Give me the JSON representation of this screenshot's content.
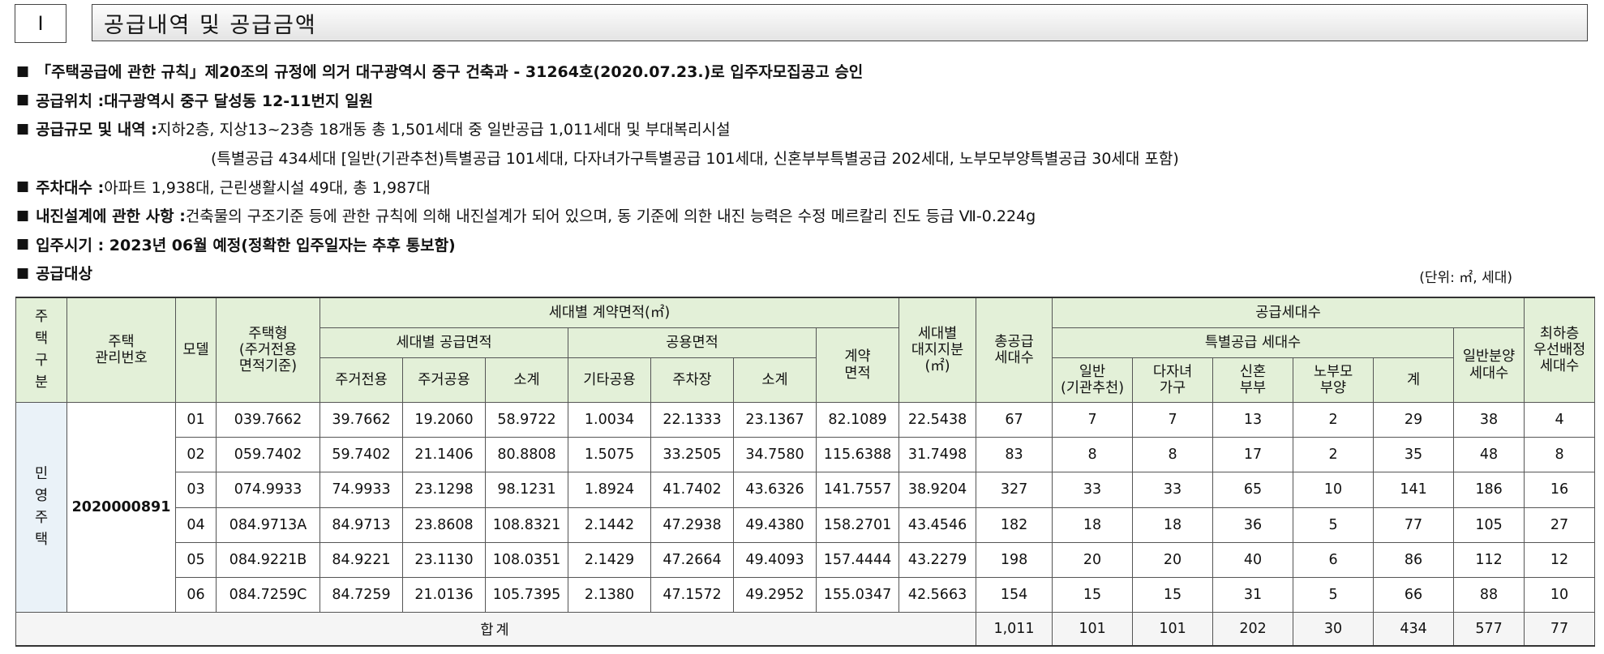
{
  "header": {
    "number": "I",
    "title": "공급내역 및 공급금액"
  },
  "bullet": "■",
  "info": [
    {
      "text": "「주택공급에 관한 규칙」제20조의 규정에 의거 대구광역시 중구 건축과 - 31264호(2020.07.23.)로 입주자모집공고 승인"
    },
    {
      "label": "공급위치 : ",
      "value": "대구광역시 중구 달성동 12-11번지 일원"
    },
    {
      "label": "공급규모 및 내역 :",
      "value": "지하2층, 지상13~23층 18개동 총 1,501세대 중 일반공급 1,011세대 및 부대복리시설"
    },
    {
      "continuation": "(특별공급 434세대 [일반(기관추천)특별공급 101세대, 다자녀가구특별공급 101세대, 신혼부부특별공급 202세대, 노부모부양특별공급 30세대 포함)"
    },
    {
      "label": "주차대수 : ",
      "value": "아파트 1,938대, 근린생활시설 49대, 총 1,987대"
    },
    {
      "label": "내진설계에 관한 사항 : ",
      "value": "건축물의 구조기준 등에 관한 규칙에 의해 내진설계가 되어 있으며, 동 기준에 의한 내진 능력은 수정 메르칼리 진도 등급 Ⅶ-0.224g"
    },
    {
      "text": "입주시기 : 2023년 06월 예정(정확한 입주일자는 추후 통보함)"
    },
    {
      "label": "공급대상"
    }
  ],
  "unit_note": "(단위: ㎡, 세대)",
  "table": {
    "headers": {
      "house_type_section": "주택구분",
      "mgmt_no": "주택\n관리번호",
      "model": "모델",
      "house_type": "주택형\n(주거전용\n면적기준)",
      "contract_area_group": "세대별 계약면적(㎡)",
      "supply_area_group": "세대별 공급면적",
      "common_area_group": "공용면적",
      "excl_residential": "주거전용",
      "common_residential": "주거공용",
      "subtotal1": "소계",
      "other_common": "기타공용",
      "parking": "주차장",
      "subtotal2": "소계",
      "contract_area": "계약\n면적",
      "land_share": "세대별\n대지지분\n(㎡)",
      "total_supply": "총공급\n세대수",
      "supply_households": "공급세대수",
      "special_supply": "특별공급 세대수",
      "sp_general": "일반\n(기관추천)",
      "sp_multichild": "다자녀\n가구",
      "sp_newlywed": "신혼\n부부",
      "sp_elderly": "노부모\n부양",
      "sp_total": "계",
      "general_sale": "일반분양\n세대수",
      "lowest_floor": "최하층\n우선배정\n세대수"
    },
    "section_label": "민영주택",
    "mgmt_number": "2020000891",
    "rows": [
      {
        "model": "01",
        "type": "039.7662",
        "excl": "39.7662",
        "comm": "19.2060",
        "sub1": "58.9722",
        "other": "1.0034",
        "parking": "22.1333",
        "sub2": "23.1367",
        "contract": "82.1089",
        "land": "22.5438",
        "total": "67",
        "sp_gen": "7",
        "sp_multi": "7",
        "sp_newly": "13",
        "sp_elder": "2",
        "sp_sum": "29",
        "general": "38",
        "lowest": "4"
      },
      {
        "model": "02",
        "type": "059.7402",
        "excl": "59.7402",
        "comm": "21.1406",
        "sub1": "80.8808",
        "other": "1.5075",
        "parking": "33.2505",
        "sub2": "34.7580",
        "contract": "115.6388",
        "land": "31.7498",
        "total": "83",
        "sp_gen": "8",
        "sp_multi": "8",
        "sp_newly": "17",
        "sp_elder": "2",
        "sp_sum": "35",
        "general": "48",
        "lowest": "8"
      },
      {
        "model": "03",
        "type": "074.9933",
        "excl": "74.9933",
        "comm": "23.1298",
        "sub1": "98.1231",
        "other": "1.8924",
        "parking": "41.7402",
        "sub2": "43.6326",
        "contract": "141.7557",
        "land": "38.9204",
        "total": "327",
        "sp_gen": "33",
        "sp_multi": "33",
        "sp_newly": "65",
        "sp_elder": "10",
        "sp_sum": "141",
        "general": "186",
        "lowest": "16"
      },
      {
        "model": "04",
        "type": "084.9713A",
        "excl": "84.9713",
        "comm": "23.8608",
        "sub1": "108.8321",
        "other": "2.1442",
        "parking": "47.2938",
        "sub2": "49.4380",
        "contract": "158.2701",
        "land": "43.4546",
        "total": "182",
        "sp_gen": "18",
        "sp_multi": "18",
        "sp_newly": "36",
        "sp_elder": "5",
        "sp_sum": "77",
        "general": "105",
        "lowest": "27"
      },
      {
        "model": "05",
        "type": "084.9221B",
        "excl": "84.9221",
        "comm": "23.1130",
        "sub1": "108.0351",
        "other": "2.1429",
        "parking": "47.2664",
        "sub2": "49.4093",
        "contract": "157.4444",
        "land": "43.2279",
        "total": "198",
        "sp_gen": "20",
        "sp_multi": "20",
        "sp_newly": "40",
        "sp_elder": "6",
        "sp_sum": "86",
        "general": "112",
        "lowest": "12"
      },
      {
        "model": "06",
        "type": "084.7259C",
        "excl": "84.7259",
        "comm": "21.0136",
        "sub1": "105.7395",
        "other": "2.1380",
        "parking": "47.1572",
        "sub2": "49.2952",
        "contract": "155.0347",
        "land": "42.5663",
        "total": "154",
        "sp_gen": "15",
        "sp_multi": "15",
        "sp_newly": "31",
        "sp_elder": "5",
        "sp_sum": "66",
        "general": "88",
        "lowest": "10"
      }
    ],
    "totals": {
      "label": "합계",
      "total": "1,011",
      "sp_gen": "101",
      "sp_multi": "101",
      "sp_newly": "202",
      "sp_elder": "30",
      "sp_sum": "434",
      "general": "577",
      "lowest": "77"
    }
  }
}
